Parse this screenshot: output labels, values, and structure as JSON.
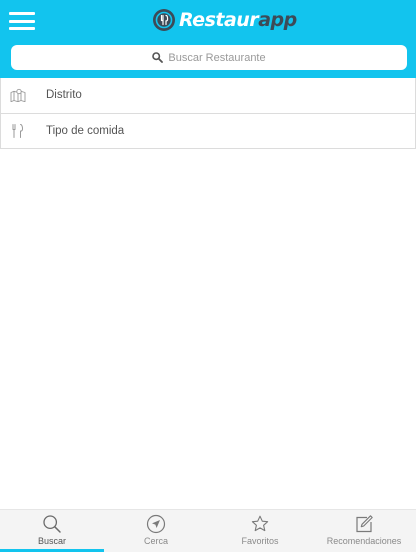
{
  "header": {
    "logo_text_part1": "Restaur",
    "logo_text_part2": "app",
    "brand_color": "#12c4ee",
    "logo_dark_color": "#3d4a57"
  },
  "search": {
    "placeholder": "Buscar Restaurante",
    "icon": "search-icon"
  },
  "filters": [
    {
      "icon": "map-icon",
      "label": "Distrito"
    },
    {
      "icon": "fork-knife-icon",
      "label": "Tipo de comida"
    }
  ],
  "tabs": [
    {
      "icon": "search-icon",
      "label": "Buscar",
      "active": true
    },
    {
      "icon": "navigation-arrow-icon",
      "label": "Cerca",
      "active": false
    },
    {
      "icon": "star-icon",
      "label": "Favoritos",
      "active": false
    },
    {
      "icon": "edit-icon",
      "label": "Recomendaciones",
      "active": false
    }
  ]
}
